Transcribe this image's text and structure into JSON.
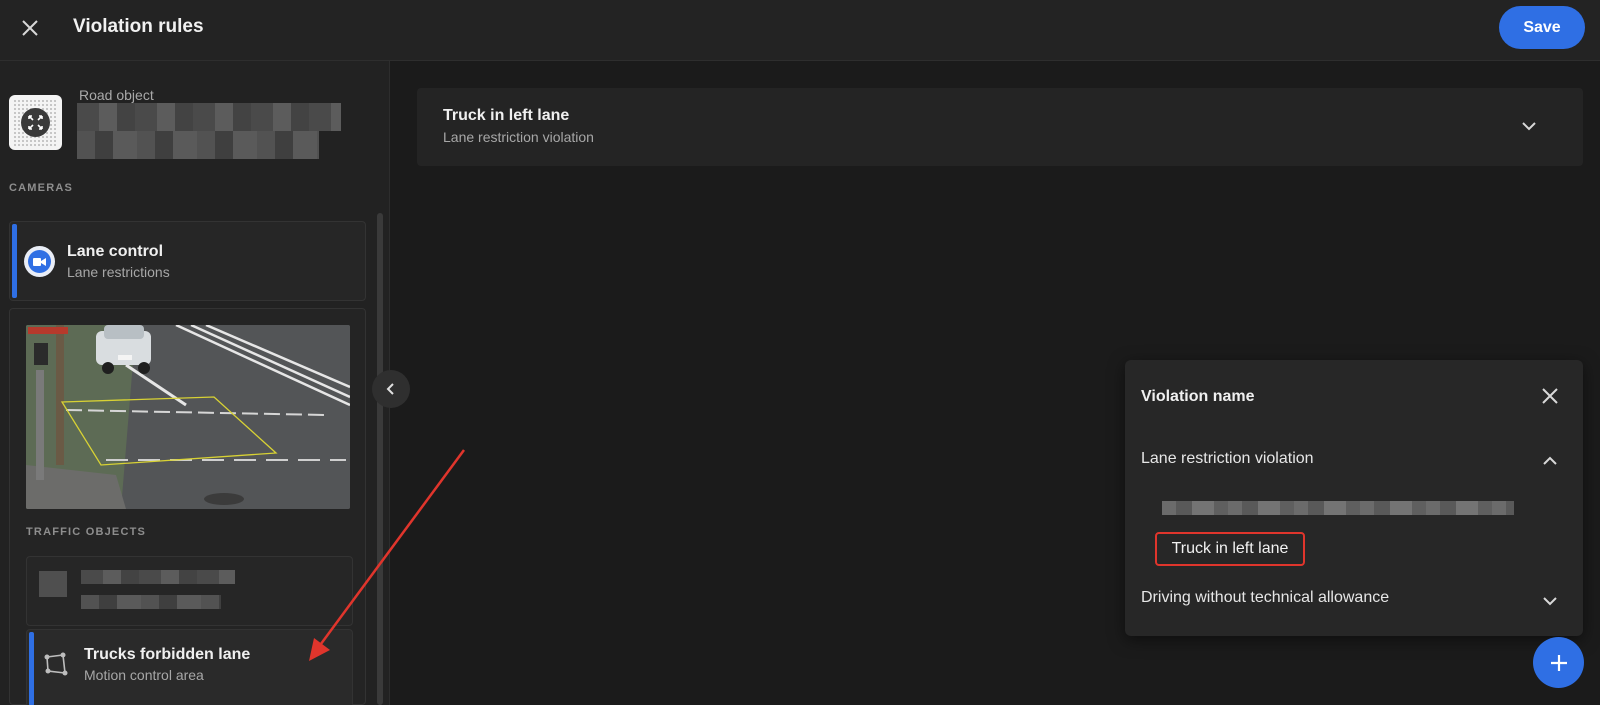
{
  "header": {
    "title": "Violation rules",
    "save_label": "Save"
  },
  "sidebar": {
    "object_label": "Road object",
    "cameras_section": "CAMERAS",
    "camera": {
      "title": "Lane control",
      "subtitle": "Lane restrictions"
    },
    "traffic_section": "TRAFFIC OBJECTS",
    "selected_object": {
      "title": "Trucks forbidden lane",
      "subtitle": "Motion control area"
    }
  },
  "main": {
    "rule": {
      "title": "Truck in left lane",
      "subtitle": "Lane restriction violation"
    }
  },
  "popup": {
    "title": "Violation name",
    "groups": [
      {
        "label": "Lane restriction violation",
        "expanded": true
      },
      {
        "label": "Driving without technical allowance",
        "expanded": false
      }
    ],
    "selected_option": "Truck in left lane"
  },
  "colors": {
    "accent": "#2f6fe4",
    "highlight_border": "#e0352c",
    "annotation_arrow": "#e0352c"
  },
  "icons": [
    "close-icon",
    "expand-arrows-icon",
    "video-camera-icon",
    "chevron-left-icon",
    "chevron-down-icon",
    "chevron-up-icon",
    "polygon-icon",
    "plus-icon"
  ]
}
